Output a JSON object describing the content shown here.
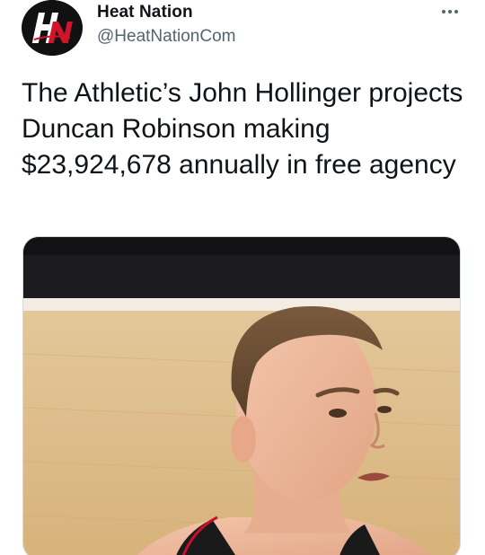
{
  "account": {
    "display_name": "Heat Nation",
    "handle": "@HeatNationCom",
    "avatar_logo_text": "HN"
  },
  "tweet": {
    "text": "The Athletic’s John Hollinger projects Duncan Robinson making $23,924,678 annually in free agency"
  },
  "icons": {
    "more": "more-horizontal-icon"
  },
  "colors": {
    "primary_text": "#0f1419",
    "secondary_text": "#536471",
    "avatar_bg": "#111111",
    "logo_red": "#d0152a"
  }
}
